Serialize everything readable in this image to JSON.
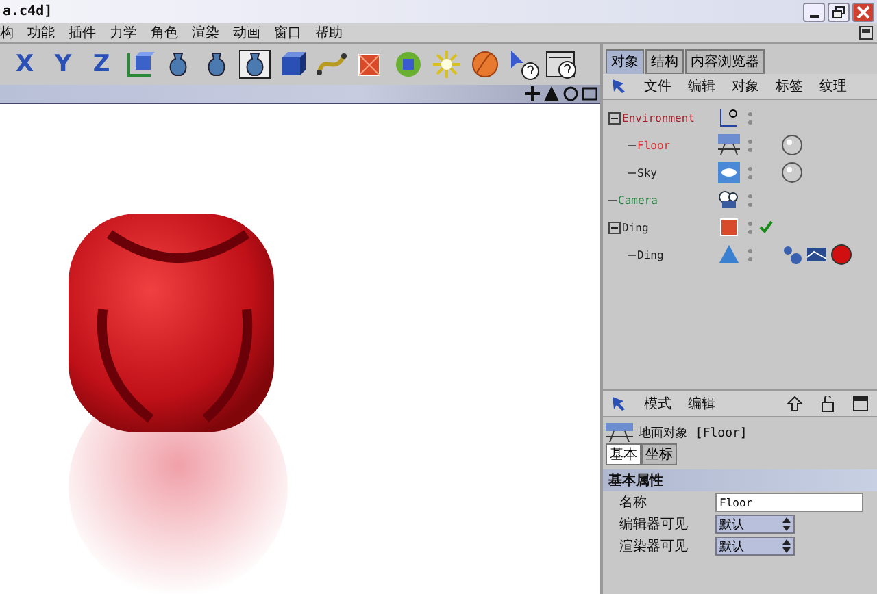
{
  "window": {
    "title": "a.c4d]"
  },
  "menu": [
    "构",
    "功能",
    "插件",
    "力学",
    "角色",
    "渲染",
    "动画",
    "窗口",
    "帮助"
  ],
  "toolbar": {
    "axis_buttons": [
      "X",
      "Y",
      "Z"
    ]
  },
  "object_manager": {
    "tabs": [
      {
        "label": "对象",
        "selected": true
      },
      {
        "label": "结构",
        "selected": false
      },
      {
        "label": "内容浏览器",
        "selected": false
      }
    ],
    "menu": [
      "文件",
      "编辑",
      "对象",
      "标签",
      "纹理"
    ],
    "tree": [
      {
        "name": "Environment",
        "color": "#a0202a",
        "expanded": true,
        "kind": "null",
        "checked": false,
        "children": [
          {
            "name": "Floor",
            "color": "#e03030",
            "kind": "floor",
            "checked": false,
            "tags": [
              {
                "kind": "material"
              }
            ]
          },
          {
            "name": "Sky",
            "color": "#202020",
            "kind": "sky",
            "checked": false,
            "tags": [
              {
                "kind": "material"
              }
            ]
          }
        ]
      },
      {
        "name": "Camera",
        "color": "#208040",
        "kind": "camera",
        "checked": false
      },
      {
        "name": "Ding",
        "color": "#202020",
        "expanded": true,
        "kind": "cube",
        "checked": true,
        "children": [
          {
            "name": "Ding",
            "color": "#202020",
            "kind": "cone",
            "checked": false,
            "tags": [
              {
                "kind": "spheres"
              },
              {
                "kind": "texture"
              },
              {
                "kind": "ball"
              }
            ]
          }
        ]
      }
    ]
  },
  "attribute_manager": {
    "menu": [
      "模式",
      "编辑"
    ],
    "object_title": "地面对象 [Floor]",
    "tabs": [
      {
        "label": "基本",
        "selected": true
      },
      {
        "label": "坐标",
        "selected": false
      }
    ],
    "section": "基本属性",
    "fields": [
      {
        "kind": "text",
        "label": "名称",
        "value": "Floor"
      },
      {
        "kind": "select",
        "label": "编辑器可见",
        "value": "默认"
      },
      {
        "kind": "select",
        "label": "渲染器可见",
        "value": "默认"
      }
    ]
  }
}
